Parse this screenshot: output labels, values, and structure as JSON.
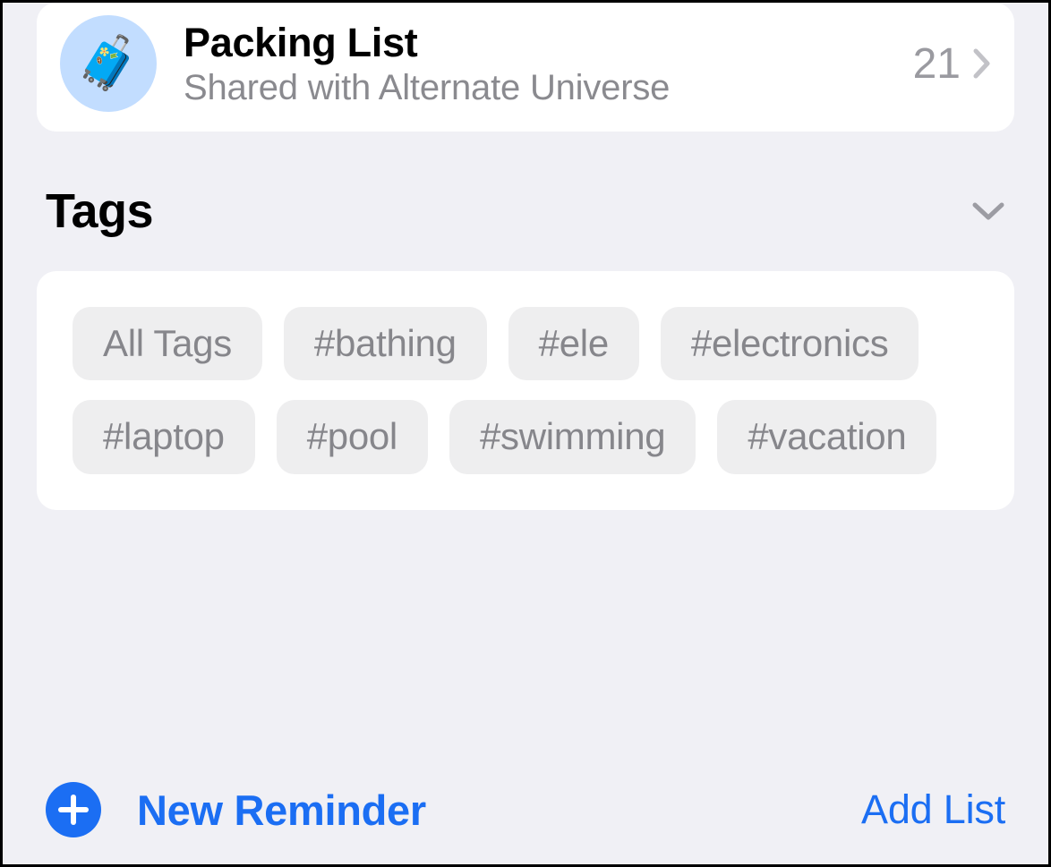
{
  "list": {
    "title": "Packing List",
    "subtitle": "Shared with Alternate Universe",
    "count": "21",
    "icon": "🧳"
  },
  "tags_section": {
    "title": "Tags"
  },
  "tags": [
    "All Tags",
    "#bathing",
    "#ele",
    "#electronics",
    "#laptop",
    "#pool",
    "#swimming",
    "#vacation"
  ],
  "toolbar": {
    "new_reminder": "New Reminder",
    "add_list": "Add List"
  }
}
